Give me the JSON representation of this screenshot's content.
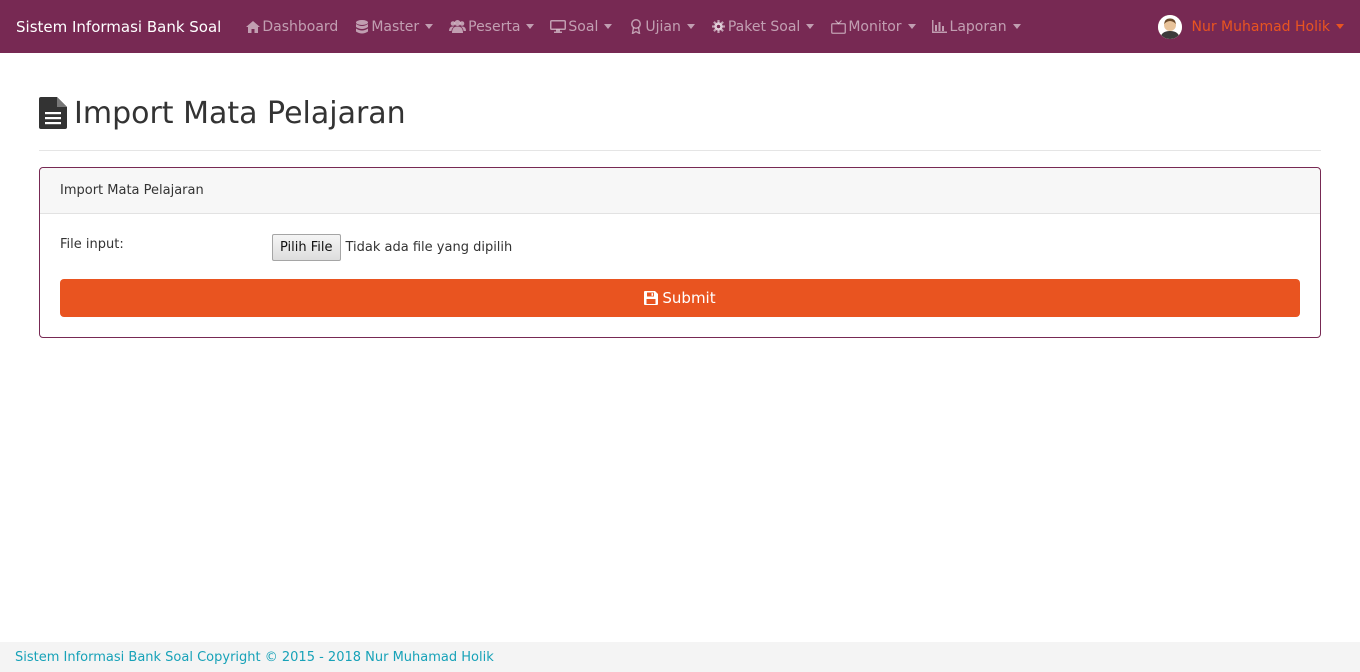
{
  "navbar": {
    "brand": "Sistem Informasi Bank Soal",
    "items": [
      {
        "label": "Dashboard",
        "icon": "home-icon",
        "dropdown": false
      },
      {
        "label": "Master",
        "icon": "database-icon",
        "dropdown": true
      },
      {
        "label": "Peserta",
        "icon": "users-icon",
        "dropdown": true
      },
      {
        "label": "Soal",
        "icon": "desktop-icon",
        "dropdown": true
      },
      {
        "label": "Ujian",
        "icon": "award-icon",
        "dropdown": true
      },
      {
        "label": "Paket Soal",
        "icon": "gear-icon",
        "dropdown": true
      },
      {
        "label": "Monitor",
        "icon": "tv-icon",
        "dropdown": true
      },
      {
        "label": "Laporan",
        "icon": "bar-chart-icon",
        "dropdown": true
      }
    ],
    "user": {
      "name": "Nur Muhamad Holik"
    }
  },
  "page": {
    "title": "Import Mata Pelajaran",
    "title_icon": "file-text-icon"
  },
  "card": {
    "header": "Import Mata Pelajaran",
    "file_label": "File input:",
    "file_button": "Pilih File",
    "file_status": "Tidak ada file yang dipilih",
    "submit_label": "Submit"
  },
  "footer": {
    "text": "Sistem Informasi Bank Soal Copyright © 2015 - 2018 Nur Muhamad Holik"
  },
  "colors": {
    "navbar": "#772953",
    "accent": "#e95420",
    "footer_text": "#17a2b8"
  }
}
